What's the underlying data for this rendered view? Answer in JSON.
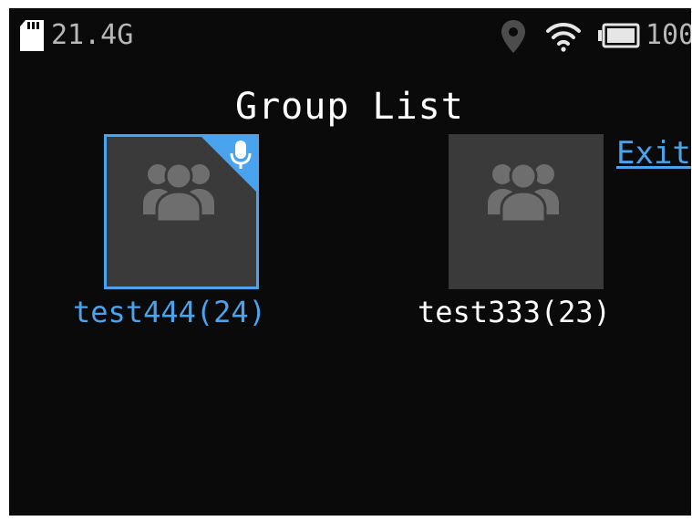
{
  "status_bar": {
    "storage": "21.4G",
    "battery": "100",
    "icons": [
      "sd-card-icon",
      "location-icon",
      "wifi-icon",
      "battery-icon"
    ]
  },
  "page": {
    "title": "Group List",
    "exit_label": "Exit"
  },
  "groups": [
    {
      "name": "test444",
      "count": "(24)",
      "label": "test444(24)",
      "selected": true,
      "speaking": true,
      "icon": "group-people-icon"
    },
    {
      "name": "test333",
      "count": "(23)",
      "label": "test333(23)",
      "selected": false,
      "speaking": false,
      "icon": "group-people-icon"
    }
  ],
  "colors": {
    "background": "#0a0a0a",
    "accent": "#4aa3ee",
    "tile": "#3a3a3a",
    "icon_gray": "#6e6e6e",
    "status_text": "#b8b8b8",
    "text": "#ffffff"
  }
}
